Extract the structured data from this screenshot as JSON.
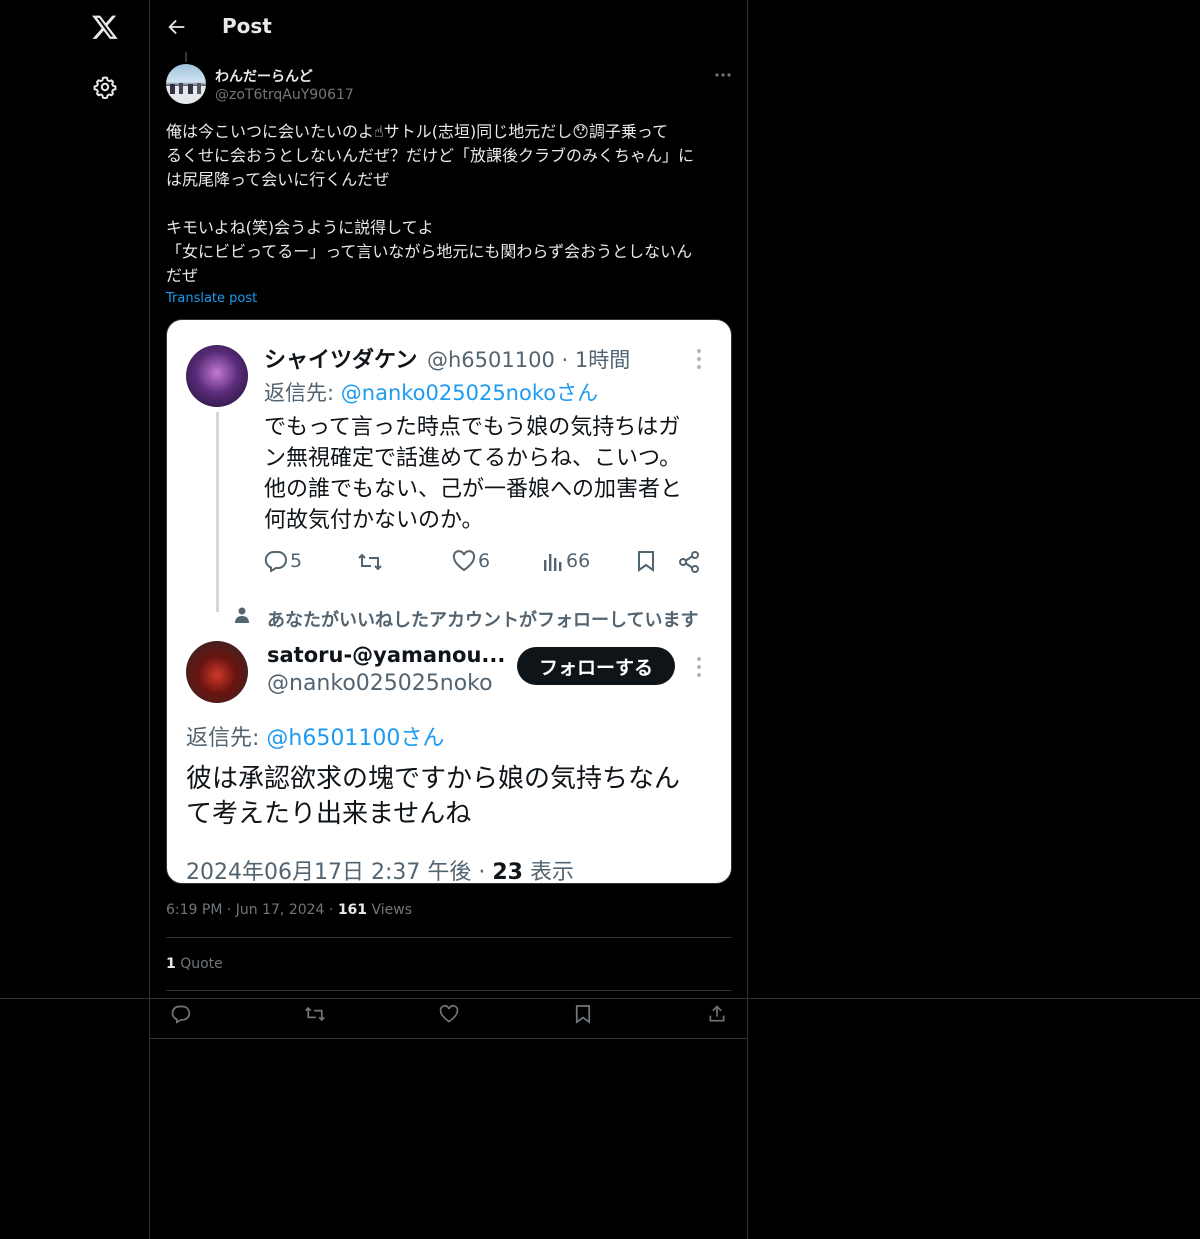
{
  "nav": {
    "logo_icon": "x-logo-icon",
    "settings_icon": "gear-icon"
  },
  "header": {
    "title": "Post",
    "back_icon": "arrow-left-icon"
  },
  "post": {
    "display_name": "わんだーらんど",
    "handle": "@zoT6trqAuY90617",
    "body": "俺は今こいつに会いたいのよ☝サトル(志垣)同じ地元だし😯調子乗って\nるくせに会おうとしないんだぜ？だけど「放課後クラブのみくちゃん」に\nは尻尾降って会いに行くんだぜ\n\nキモいよね(笑)会うように説得してよ\n「女にビビってるー」って言いながら地元にも関わらず会おうとしないん\nだぜ",
    "translate": "Translate post",
    "time": "6:19 PM",
    "date": "Jun 17, 2024",
    "views_count": "161",
    "views_label": "Views",
    "quote_count": "1",
    "quote_label": "Quote"
  },
  "screenshot": {
    "tweet1": {
      "name": "シャイツダケン",
      "handle_time": "@h6501100 · 1時間",
      "reply_prefix": "返信先: ",
      "reply_to": "@nanko025025nokoさん",
      "lines": [
        "でもって言った時点でもう娘の気持ちはガ",
        "ン無視確定で話進めてるからね、こいつ。",
        "他の誰でもない、己が一番娘への加害者と",
        "何故気付かないのか。"
      ],
      "replies": "5",
      "likes": "6",
      "views": "66"
    },
    "social_context": "あなたがいいねしたアカウントがフォローしています",
    "tweet2": {
      "name": "satoru-@yamanou...",
      "handle": "@nanko025025noko",
      "follow": "フォローする",
      "reply_prefix": "返信先: ",
      "reply_to": "@h6501100さん",
      "lines": [
        "彼は承認欲求の塊ですから娘の気持ちなん",
        "て考えたり出来ませんね"
      ],
      "timestamp": "2024年06月17日 2:37 午後 · ",
      "views_count": "23",
      "views_label": " 表示"
    }
  },
  "actions": [
    "reply-icon",
    "repost-icon",
    "like-icon",
    "bookmark-icon",
    "share-icon"
  ]
}
